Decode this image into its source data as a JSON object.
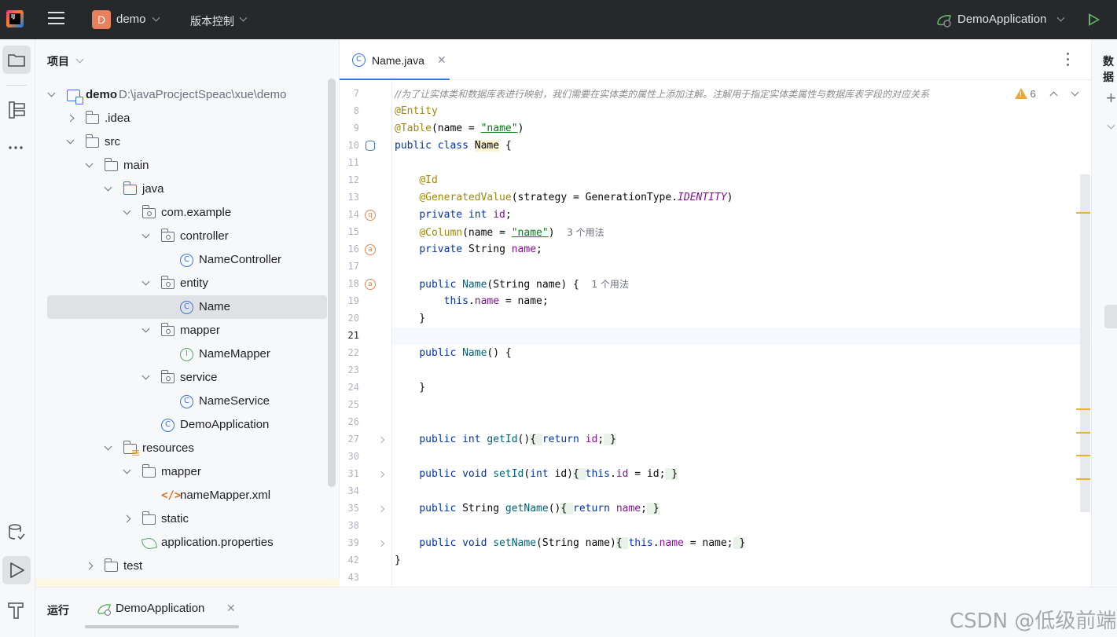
{
  "titlebar": {
    "project_initial": "D",
    "project_name": "demo",
    "vcs_label": "版本控制",
    "run_config": "DemoApplication"
  },
  "project_panel": {
    "title": "项目",
    "tree": [
      {
        "label": "demo",
        "path": "D:\\javaProcjectSpeac\\xue\\demo",
        "icon": "module-icon",
        "indent": 0,
        "arrow": "down"
      },
      {
        "label": ".idea",
        "icon": "folder-icon",
        "indent": 1,
        "arrow": "right"
      },
      {
        "label": "src",
        "icon": "folder-icon",
        "indent": 1,
        "arrow": "down"
      },
      {
        "label": "main",
        "icon": "folder-icon",
        "indent": 2,
        "arrow": "down"
      },
      {
        "label": "java",
        "icon": "source-folder-icon",
        "indent": 3,
        "arrow": "down"
      },
      {
        "label": "com.example",
        "icon": "package-icon",
        "indent": 4,
        "arrow": "down"
      },
      {
        "label": "controller",
        "icon": "package-icon",
        "indent": 5,
        "arrow": "down"
      },
      {
        "label": "NameController",
        "icon": "class-icon",
        "indent": 6,
        "arrow": "none"
      },
      {
        "label": "entity",
        "icon": "package-icon",
        "indent": 5,
        "arrow": "down"
      },
      {
        "label": "Name",
        "icon": "class-icon",
        "indent": 6,
        "arrow": "none",
        "selected": true
      },
      {
        "label": "mapper",
        "icon": "package-icon",
        "indent": 5,
        "arrow": "down"
      },
      {
        "label": "NameMapper",
        "icon": "interface-icon",
        "indent": 6,
        "arrow": "none"
      },
      {
        "label": "service",
        "icon": "package-icon",
        "indent": 5,
        "arrow": "down"
      },
      {
        "label": "NameService",
        "icon": "class-icon",
        "indent": 6,
        "arrow": "none"
      },
      {
        "label": "DemoApplication",
        "icon": "spring-boot-class-icon",
        "indent": 5,
        "arrow": "none"
      },
      {
        "label": "resources",
        "icon": "resources-folder-icon",
        "indent": 3,
        "arrow": "down"
      },
      {
        "label": "mapper",
        "icon": "folder-icon",
        "indent": 4,
        "arrow": "down"
      },
      {
        "label": "nameMapper.xml",
        "icon": "xml-file-icon",
        "indent": 5,
        "arrow": "none"
      },
      {
        "label": "static",
        "icon": "folder-icon",
        "indent": 4,
        "arrow": "right"
      },
      {
        "label": "application.properties",
        "icon": "spring-properties-icon",
        "indent": 4,
        "arrow": "none"
      },
      {
        "label": "test",
        "icon": "folder-icon",
        "indent": 2,
        "arrow": "right"
      }
    ]
  },
  "editor": {
    "tab_label": "Name.java",
    "inspection_count": "6",
    "line_numbers": [
      "7",
      "8",
      "9",
      "10",
      "11",
      "12",
      "13",
      "14",
      "15",
      "16",
      "17",
      "18",
      "19",
      "20",
      "21",
      "22",
      "23",
      "24",
      "25",
      "26",
      "27",
      "30",
      "31",
      "34",
      "35",
      "38",
      "39",
      "42",
      "43"
    ],
    "current_line": "21",
    "usage_hints": {
      "column": "3 个用法",
      "constructor": "1 个用法"
    },
    "comment": "//为了让实体类和数据库表进行映射，我们需要在实体类的属性上添加注解。注解用于指定实体类属性与数据库表字段的对应关系",
    "annotations": {
      "entity": "@Entity",
      "table": "@Table",
      "id": "@Id",
      "generated": "@GeneratedValue",
      "column": "@Column"
    },
    "table_name": "\"name\"",
    "class_name": "Name",
    "identity": "IDENTITY"
  },
  "right_panel": {
    "title": "数据"
  },
  "run_panel": {
    "title": "运行",
    "tab_label": "DemoApplication"
  },
  "watermark": "CSDN @低级前端",
  "colors": {
    "accent": "#3574f0",
    "titlebar": "#27282c",
    "annotation": "#9e880d",
    "keyword": "#0033b3",
    "warning": "#f0a732"
  }
}
